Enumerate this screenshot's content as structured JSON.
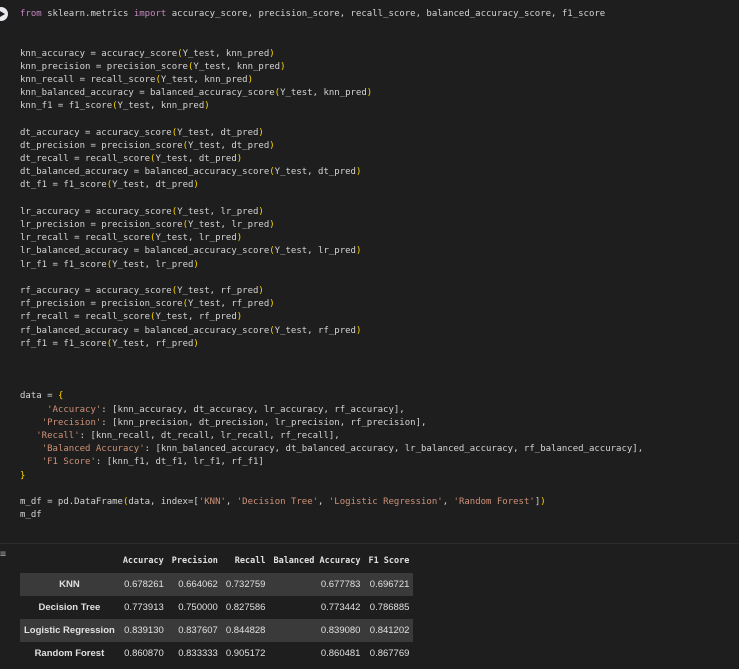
{
  "code_lines": [
    [
      [
        "kw",
        "from"
      ],
      [
        "txt",
        " sklearn.metrics "
      ],
      [
        "kw",
        "import"
      ],
      [
        "txt",
        " accuracy_score, precision_score, recall_score, balanced_accuracy_score, f1_score"
      ]
    ],
    [],
    [],
    [
      [
        "txt",
        "knn_accuracy = accuracy_score"
      ],
      [
        "br",
        "("
      ],
      [
        "txt",
        "Y_test, knn_pred"
      ],
      [
        "br",
        ")"
      ]
    ],
    [
      [
        "txt",
        "knn_precision = precision_score"
      ],
      [
        "br",
        "("
      ],
      [
        "txt",
        "Y_test, knn_pred"
      ],
      [
        "br",
        ")"
      ]
    ],
    [
      [
        "txt",
        "knn_recall = recall_score"
      ],
      [
        "br",
        "("
      ],
      [
        "txt",
        "Y_test, knn_pred"
      ],
      [
        "br",
        ")"
      ]
    ],
    [
      [
        "txt",
        "knn_balanced_accuracy = balanced_accuracy_score"
      ],
      [
        "br",
        "("
      ],
      [
        "txt",
        "Y_test, knn_pred"
      ],
      [
        "br",
        ")"
      ]
    ],
    [
      [
        "txt",
        "knn_f1 = f1_score"
      ],
      [
        "br",
        "("
      ],
      [
        "txt",
        "Y_test, knn_pred"
      ],
      [
        "br",
        ")"
      ]
    ],
    [],
    [
      [
        "txt",
        "dt_accuracy = accuracy_score"
      ],
      [
        "br",
        "("
      ],
      [
        "txt",
        "Y_test, dt_pred"
      ],
      [
        "br",
        ")"
      ]
    ],
    [
      [
        "txt",
        "dt_precision = precision_score"
      ],
      [
        "br",
        "("
      ],
      [
        "txt",
        "Y_test, dt_pred"
      ],
      [
        "br",
        ")"
      ]
    ],
    [
      [
        "txt",
        "dt_recall = recall_score"
      ],
      [
        "br",
        "("
      ],
      [
        "txt",
        "Y_test, dt_pred"
      ],
      [
        "br",
        ")"
      ]
    ],
    [
      [
        "txt",
        "dt_balanced_accuracy = balanced_accuracy_score"
      ],
      [
        "br",
        "("
      ],
      [
        "txt",
        "Y_test, dt_pred"
      ],
      [
        "br",
        ")"
      ]
    ],
    [
      [
        "txt",
        "dt_f1 = f1_score"
      ],
      [
        "br",
        "("
      ],
      [
        "txt",
        "Y_test, dt_pred"
      ],
      [
        "br",
        ")"
      ]
    ],
    [],
    [
      [
        "txt",
        "lr_accuracy = accuracy_score"
      ],
      [
        "br",
        "("
      ],
      [
        "txt",
        "Y_test, lr_pred"
      ],
      [
        "br",
        ")"
      ]
    ],
    [
      [
        "txt",
        "lr_precision = precision_score"
      ],
      [
        "br",
        "("
      ],
      [
        "txt",
        "Y_test, lr_pred"
      ],
      [
        "br",
        ")"
      ]
    ],
    [
      [
        "txt",
        "lr_recall = recall_score"
      ],
      [
        "br",
        "("
      ],
      [
        "txt",
        "Y_test, lr_pred"
      ],
      [
        "br",
        ")"
      ]
    ],
    [
      [
        "txt",
        "lr_balanced_accuracy = balanced_accuracy_score"
      ],
      [
        "br",
        "("
      ],
      [
        "txt",
        "Y_test, lr_pred"
      ],
      [
        "br",
        ")"
      ]
    ],
    [
      [
        "txt",
        "lr_f1 = f1_score"
      ],
      [
        "br",
        "("
      ],
      [
        "txt",
        "Y_test, lr_pred"
      ],
      [
        "br",
        ")"
      ]
    ],
    [],
    [
      [
        "txt",
        "rf_accuracy = accuracy_score"
      ],
      [
        "br",
        "("
      ],
      [
        "txt",
        "Y_test, rf_pred"
      ],
      [
        "br",
        ")"
      ]
    ],
    [
      [
        "txt",
        "rf_precision = precision_score"
      ],
      [
        "br",
        "("
      ],
      [
        "txt",
        "Y_test, rf_pred"
      ],
      [
        "br",
        ")"
      ]
    ],
    [
      [
        "txt",
        "rf_recall = recall_score"
      ],
      [
        "br",
        "("
      ],
      [
        "txt",
        "Y_test, rf_pred"
      ],
      [
        "br",
        ")"
      ]
    ],
    [
      [
        "txt",
        "rf_balanced_accuracy = balanced_accuracy_score"
      ],
      [
        "br",
        "("
      ],
      [
        "txt",
        "Y_test, rf_pred"
      ],
      [
        "br",
        ")"
      ]
    ],
    [
      [
        "txt",
        "rf_f1 = f1_score"
      ],
      [
        "br",
        "("
      ],
      [
        "txt",
        "Y_test, rf_pred"
      ],
      [
        "br",
        ")"
      ]
    ],
    [],
    [],
    [],
    [
      [
        "txt",
        "data = "
      ],
      [
        "br",
        "{"
      ]
    ],
    [
      [
        "txt",
        "     "
      ],
      [
        "str",
        "'Accuracy'"
      ],
      [
        "txt",
        ": [knn_accuracy, dt_accuracy, lr_accuracy, rf_accuracy],"
      ]
    ],
    [
      [
        "txt",
        "    "
      ],
      [
        "str",
        "'Precision'"
      ],
      [
        "txt",
        ": [knn_precision, dt_precision, lr_precision, rf_precision],"
      ]
    ],
    [
      [
        "txt",
        "   "
      ],
      [
        "str",
        "'Recall'"
      ],
      [
        "txt",
        ": [knn_recall, dt_recall, lr_recall, rf_recall],"
      ]
    ],
    [
      [
        "txt",
        "    "
      ],
      [
        "str",
        "'Balanced Accuracy'"
      ],
      [
        "txt",
        ": [knn_balanced_accuracy, dt_balanced_accuracy, lr_balanced_accuracy, rf_balanced_accuracy],"
      ]
    ],
    [
      [
        "txt",
        "    "
      ],
      [
        "str",
        "'F1 Score'"
      ],
      [
        "txt",
        ": [knn_f1, dt_f1, lr_f1, rf_f1]"
      ]
    ],
    [
      [
        "br",
        "}"
      ]
    ],
    [],
    [
      [
        "txt",
        "m_df = pd.DataFrame"
      ],
      [
        "br",
        "("
      ],
      [
        "txt",
        "data, index=["
      ],
      [
        "str",
        "'KNN'"
      ],
      [
        "txt",
        ", "
      ],
      [
        "str",
        "'Decision Tree'"
      ],
      [
        "txt",
        ", "
      ],
      [
        "str",
        "'Logistic Regression'"
      ],
      [
        "txt",
        ", "
      ],
      [
        "str",
        "'Random Forest'"
      ],
      [
        "txt",
        "]"
      ],
      [
        "br",
        ")"
      ]
    ],
    [
      [
        "txt",
        "m_df"
      ]
    ]
  ],
  "output_table": {
    "columns": [
      "Accuracy",
      "Precision",
      "Recall",
      "Balanced Accuracy",
      "F1 Score"
    ],
    "rows": [
      {
        "index": "KNN",
        "values": [
          "0.678261",
          "0.664062",
          "0.732759",
          "0.677783",
          "0.696721"
        ]
      },
      {
        "index": "Decision Tree",
        "values": [
          "0.773913",
          "0.750000",
          "0.827586",
          "0.773442",
          "0.786885"
        ]
      },
      {
        "index": "Logistic Regression",
        "values": [
          "0.839130",
          "0.837607",
          "0.844828",
          "0.839080",
          "0.841202"
        ]
      },
      {
        "index": "Random Forest",
        "values": [
          "0.860870",
          "0.833333",
          "0.905172",
          "0.860481",
          "0.867769"
        ]
      }
    ]
  },
  "icons": {
    "run": "play-circle-icon",
    "output": "output-toggle-icon"
  },
  "colors": {
    "background": "#1e1e1e",
    "keyword": "#c586c0",
    "bracket": "#ffd700",
    "string": "#ce9178",
    "row_stripe": "#3a3a3a"
  }
}
